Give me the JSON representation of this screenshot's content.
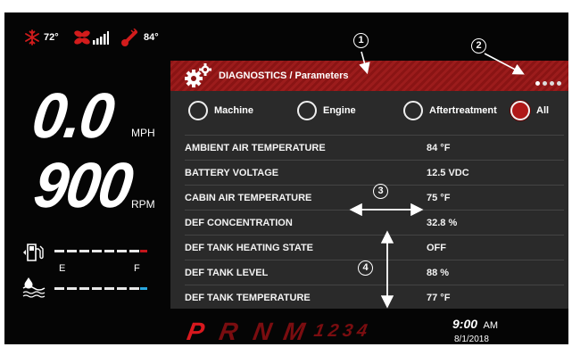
{
  "status_bar": {
    "outside_temp": "72°",
    "engine_temp": "84°"
  },
  "speed": {
    "value": "0.0",
    "unit": "MPH"
  },
  "engine_speed": {
    "value": "900",
    "unit": "RPM"
  },
  "fuel_gauge": {
    "level": 1.0
  },
  "def_gauge": {
    "empty_label": "E",
    "full_label": "F",
    "level": 1.0
  },
  "diagnostics": {
    "title": "DIAGNOSTICS / Parameters",
    "page_dots": 4,
    "filters": [
      {
        "label": "Machine",
        "selected": false
      },
      {
        "label": "Engine",
        "selected": false
      },
      {
        "label": "Aftertreatment",
        "selected": false
      },
      {
        "label": "All",
        "selected": true
      }
    ],
    "rows": [
      {
        "name": "AMBIENT AIR TEMPERATURE",
        "value": "84 °F"
      },
      {
        "name": "BATTERY VOLTAGE",
        "value": "12.5 VDC"
      },
      {
        "name": "CABIN AIR TEMPERATURE",
        "value": "75 °F"
      },
      {
        "name": "DEF CONCENTRATION",
        "value": "32.8 %"
      },
      {
        "name": "DEF TANK HEATING STATE",
        "value": "OFF"
      },
      {
        "name": "DEF TANK LEVEL",
        "value": "88 %"
      },
      {
        "name": "DEF TANK TEMPERATURE",
        "value": "77 °F"
      }
    ]
  },
  "gear_selector": {
    "gears": [
      "P",
      "R",
      "N",
      "M",
      "1",
      "2",
      "3",
      "4"
    ],
    "active": "P"
  },
  "clock": {
    "time": "9:00",
    "ampm": "AM",
    "date": "8/1/2018"
  },
  "callouts": [
    "1",
    "2",
    "3",
    "4"
  ],
  "colors": {
    "accent_red": "#c4161c",
    "header_red": "#8a1414",
    "def_blue": "#2aa8e0",
    "panel_bg": "#2a2a2a"
  }
}
